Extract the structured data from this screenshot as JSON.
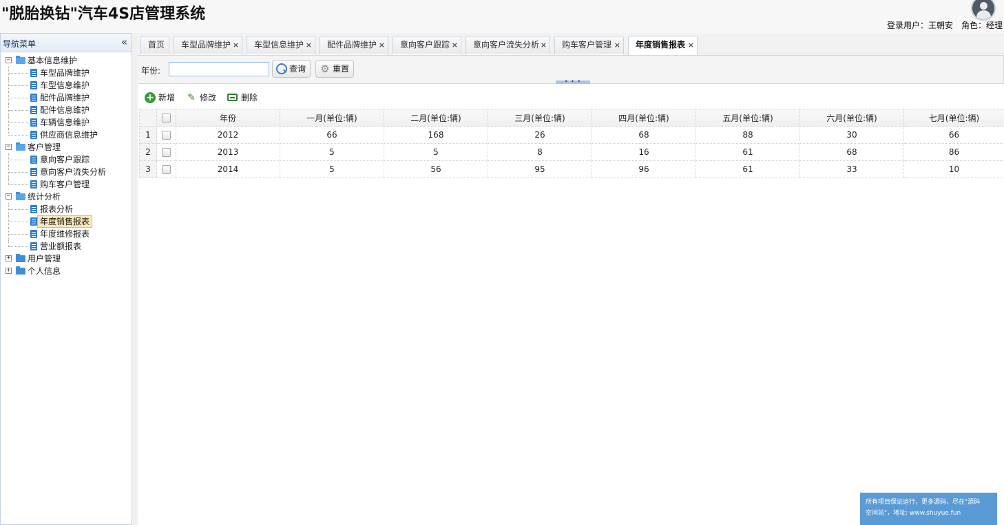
{
  "app": {
    "title": "\"脱胎换钻\"汽车4S店管理系统",
    "user_label": "登录用户：",
    "user_name": "王朝安",
    "role_label": "角色：",
    "role_name": "经理"
  },
  "sidebar": {
    "title": "导航菜单",
    "groups": [
      {
        "label": "基本信息维护",
        "expanded": true,
        "items": [
          "车型品牌维护",
          "车型信息维护",
          "配件品牌维护",
          "配件信息维护",
          "车辆信息维护",
          "供应商信息维护"
        ]
      },
      {
        "label": "客户管理",
        "expanded": true,
        "items": [
          "意向客户跟踪",
          "意向客户流失分析",
          "购车客户管理"
        ]
      },
      {
        "label": "统计分析",
        "expanded": true,
        "items": [
          "报表分析",
          "年度销售报表",
          "年度维修报表",
          "营业额报表"
        ]
      },
      {
        "label": "用户管理",
        "expanded": false,
        "items": []
      },
      {
        "label": "个人信息",
        "expanded": false,
        "items": []
      }
    ],
    "selected_item": "年度销售报表"
  },
  "tabs": [
    {
      "label": "首页",
      "closable": false,
      "active": false
    },
    {
      "label": "车型品牌维护",
      "closable": true,
      "active": false
    },
    {
      "label": "车型信息维护",
      "closable": true,
      "active": false
    },
    {
      "label": "配件品牌维护",
      "closable": true,
      "active": false
    },
    {
      "label": "意向客户跟踪",
      "closable": true,
      "active": false
    },
    {
      "label": "意向客户流失分析",
      "closable": true,
      "active": false
    },
    {
      "label": "购车客户管理",
      "closable": true,
      "active": false
    },
    {
      "label": "年度销售报表",
      "closable": true,
      "active": true
    }
  ],
  "search": {
    "year_label": "年份:",
    "year_value": "",
    "query_button": "查询",
    "reset_button": "重置"
  },
  "toolbar": {
    "add_label": "新增",
    "edit_label": "修改",
    "delete_label": "删除"
  },
  "grid": {
    "columns": [
      "年份",
      "一月(单位:辆)",
      "二月(单位:辆)",
      "三月(单位:辆)",
      "四月(单位:辆)",
      "五月(单位:辆)",
      "六月(单位:辆)",
      "七月(单位:辆)"
    ],
    "rows": [
      {
        "num": "1",
        "cells": [
          "2012",
          "66",
          "168",
          "26",
          "68",
          "88",
          "30",
          "66"
        ]
      },
      {
        "num": "2",
        "cells": [
          "2013",
          "5",
          "5",
          "8",
          "16",
          "61",
          "68",
          "86"
        ]
      },
      {
        "num": "3",
        "cells": [
          "2014",
          "5",
          "56",
          "95",
          "96",
          "61",
          "33",
          "10"
        ]
      }
    ]
  },
  "watermark": {
    "line1": "所有项目保证运行，更多源码，尽在\"源码",
    "line2": "空间站\"，地址: www.shuyue.fun"
  },
  "colors": {
    "accent": "#95b8e7",
    "border": "#c5d3e4",
    "folder": "#3d8fd9",
    "selected_bg": "#fbe7b5",
    "watermark_bg": "#5a9bd5"
  }
}
